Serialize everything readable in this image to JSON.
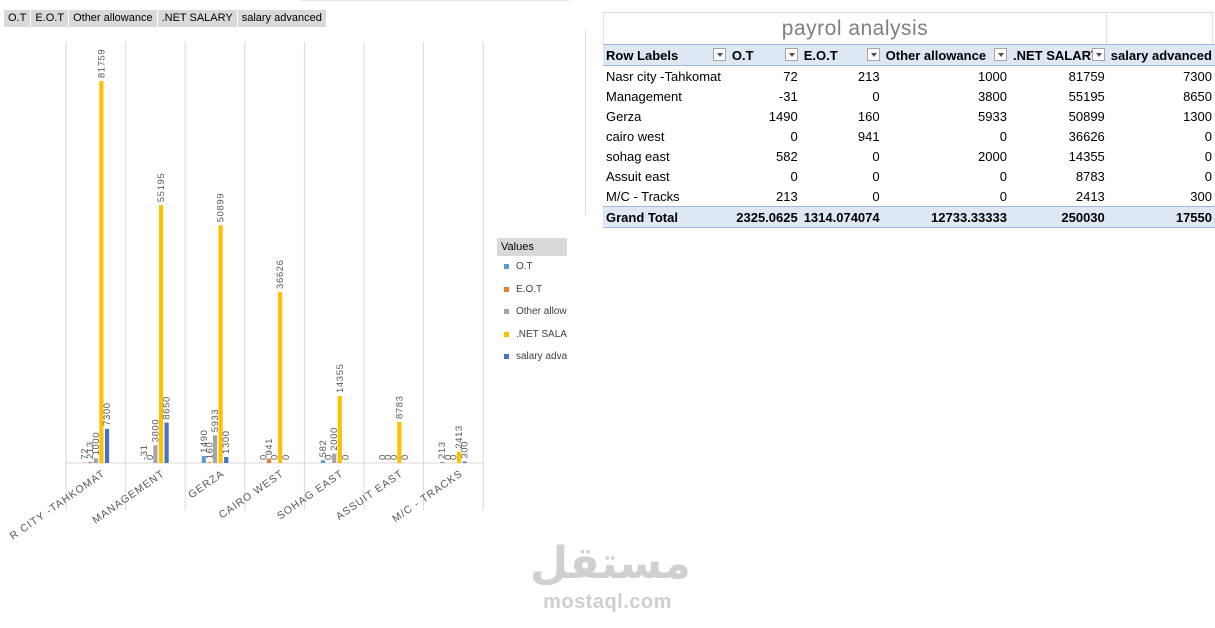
{
  "field_buttons": [
    "O.T",
    "E.O.T",
    "Other allowance",
    ".NET SALARY",
    "salary advanced"
  ],
  "legend": {
    "title": "Values",
    "items": [
      {
        "label": "O.T",
        "color": "#5b9bd5"
      },
      {
        "label": "E.O.T",
        "color": "#ed7d31"
      },
      {
        "label": "Other allow",
        "color": "#a5a5a5"
      },
      {
        "label": ".NET SALAR",
        "color": "#ffc000"
      },
      {
        "label": "salary adva",
        "color": "#4472c4"
      }
    ]
  },
  "chart_data": {
    "type": "bar",
    "categories": [
      "NASR CITY -TAHKOMAT",
      "MANAGEMENT",
      "GERZA",
      "CAIRO WEST",
      "SOHAG EAST",
      "ASSUIT EAST",
      "M/C - TRACKS"
    ],
    "category_labels_visible": [
      "R CITY -TAHKOMAT",
      "MANAGEMENT",
      "GERZA",
      "CAIRO WEST",
      "SOHAG EAST",
      "ASSUIT EAST",
      "M/C - TRACKS"
    ],
    "series": [
      {
        "name": "O.T",
        "color": "#5b9bd5",
        "values": [
          72,
          -31,
          1490,
          0,
          582,
          0,
          213
        ]
      },
      {
        "name": "E.O.T",
        "color": "#ed7d31",
        "values": [
          213,
          0,
          160,
          941,
          0,
          0,
          0
        ]
      },
      {
        "name": "Other allowance",
        "color": "#a5a5a5",
        "values": [
          1000,
          3800,
          5933,
          0,
          2000,
          0,
          0
        ]
      },
      {
        "name": ".NET SALARY",
        "color": "#ffc000",
        "values": [
          81759,
          55195,
          50899,
          36626,
          14355,
          8783,
          2413
        ]
      },
      {
        "name": "salary advanced",
        "color": "#4472c4",
        "values": [
          7300,
          8650,
          1300,
          0,
          0,
          0,
          300
        ]
      }
    ],
    "title": "",
    "xlabel": "",
    "ylabel": "",
    "ylim": [
      0,
      82000
    ],
    "grid": "vertical category separators",
    "legend": "right",
    "data_labels": true
  },
  "pivot": {
    "title": "payrol  analysis",
    "headers": [
      "Row Labels",
      "O.T",
      "E.O.T",
      "Other allowance",
      ".NET SALARY",
      "salary advanced"
    ],
    "rows": [
      [
        "Nasr city -Tahkomat",
        "72",
        "213",
        "1000",
        "81759",
        "7300"
      ],
      [
        "Management",
        "-31",
        "0",
        "3800",
        "55195",
        "8650"
      ],
      [
        "Gerza",
        "1490",
        "160",
        "5933",
        "50899",
        "1300"
      ],
      [
        "cairo west",
        "0",
        "941",
        "0",
        "36626",
        "0"
      ],
      [
        "sohag east",
        "582",
        "0",
        "2000",
        "14355",
        "0"
      ],
      [
        "Assuit east",
        "0",
        "0",
        "0",
        "8783",
        "0"
      ],
      [
        "M/C - Tracks",
        "213",
        "0",
        "0",
        "2413",
        "300"
      ]
    ],
    "total": [
      "Grand Total",
      "2325.0625",
      "1314.074074",
      "12733.33333",
      "250030",
      "17550"
    ]
  },
  "watermark": {
    "arabic": "مستقل",
    "latin": "mostaql.com"
  }
}
